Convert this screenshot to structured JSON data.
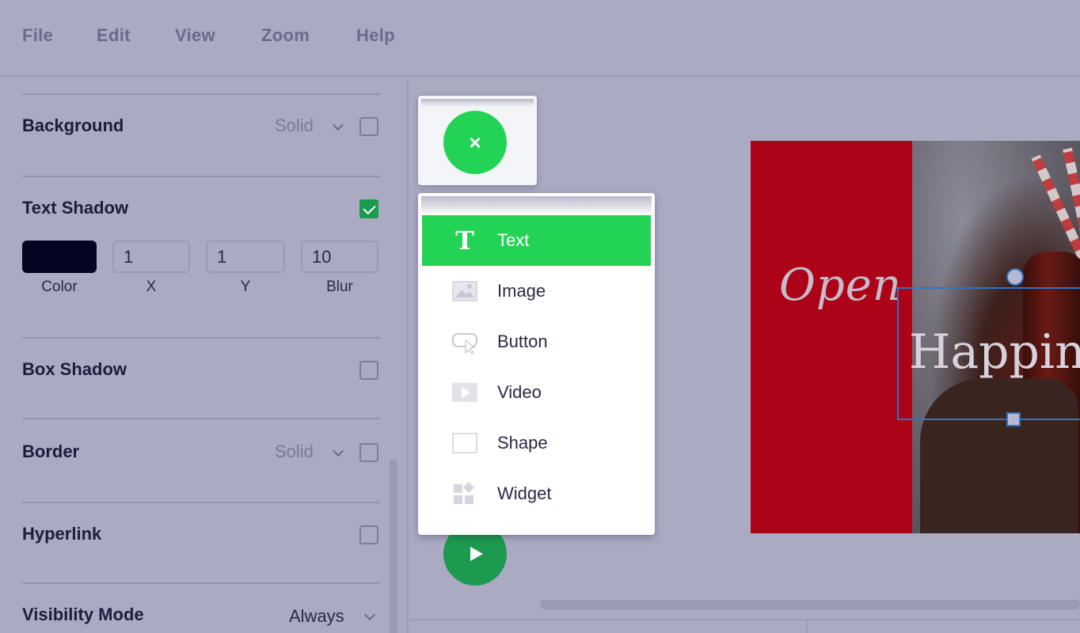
{
  "menubar": {
    "items": [
      "File",
      "Edit",
      "View",
      "Zoom",
      "Help"
    ]
  },
  "panel": {
    "background": {
      "label": "Background",
      "style": "Solid",
      "enabled": false
    },
    "text_shadow": {
      "label": "Text Shadow",
      "enabled": true,
      "color_value": "#050521",
      "color_label": "Color",
      "x_value": "1",
      "x_label": "X",
      "y_value": "1",
      "y_label": "Y",
      "blur_value": "10",
      "blur_label": "Blur"
    },
    "box_shadow": {
      "label": "Box Shadow",
      "enabled": false
    },
    "border": {
      "label": "Border",
      "style": "Solid",
      "enabled": false
    },
    "hyperlink": {
      "label": "Hyperlink",
      "enabled": false
    },
    "visibility": {
      "label": "Visibility Mode",
      "value": "Always"
    }
  },
  "add_menu": {
    "close_symbol": "×",
    "items": [
      {
        "label": "Text",
        "icon": "text-icon",
        "active": true
      },
      {
        "label": "Image",
        "icon": "image-icon",
        "active": false
      },
      {
        "label": "Button",
        "icon": "button-icon",
        "active": false
      },
      {
        "label": "Video",
        "icon": "video-icon",
        "active": false
      },
      {
        "label": "Shape",
        "icon": "shape-icon",
        "active": false
      },
      {
        "label": "Widget",
        "icon": "widget-icon",
        "active": false
      }
    ]
  },
  "slide": {
    "left_text": "Open",
    "right_text": "Happiness",
    "accent_color": "#ad0319"
  },
  "colors": {
    "primary_green": "#23d355",
    "dark_green": "#1c9a50",
    "selection_blue": "#2b74c7"
  }
}
